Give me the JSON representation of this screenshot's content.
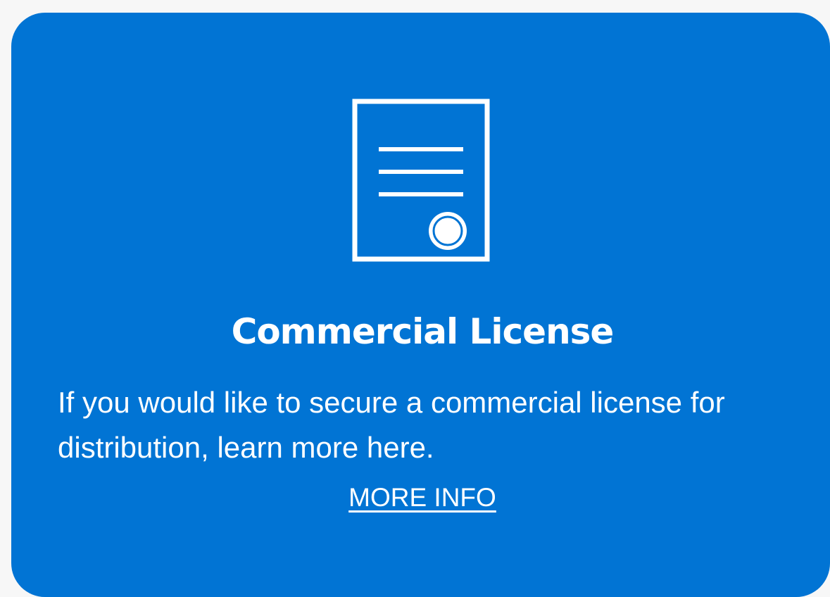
{
  "card": {
    "background_color": "#0174d4",
    "icon": "license-certificate-icon",
    "title": "Commercial License",
    "description": "If you would like to secure a commercial license for distribution, learn more here.",
    "link_label": "MORE INFO"
  }
}
